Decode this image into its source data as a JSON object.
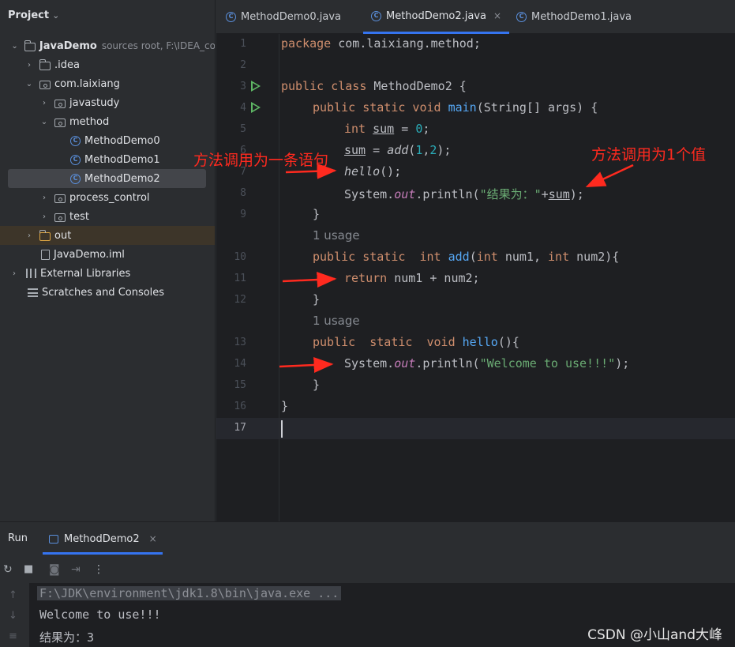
{
  "project_panel": {
    "title": "Project",
    "tree": [
      {
        "label": "JavaDemo",
        "note": "sources root,  F:\\IDEA_co"
      },
      {
        "label": ".idea"
      },
      {
        "label": "com.laixiang"
      },
      {
        "label": "javastudy"
      },
      {
        "label": "method"
      },
      {
        "label": "MethodDemo0"
      },
      {
        "label": "MethodDemo1"
      },
      {
        "label": "MethodDemo2"
      },
      {
        "label": "process_control"
      },
      {
        "label": "test"
      },
      {
        "label": "out"
      },
      {
        "label": "JavaDemo.iml"
      },
      {
        "label": "External Libraries"
      },
      {
        "label": "Scratches and Consoles"
      }
    ]
  },
  "editor_tabs": [
    {
      "label": "MethodDemo0.java"
    },
    {
      "label": "MethodDemo2.java",
      "active": true
    },
    {
      "label": "MethodDemo1.java"
    }
  ],
  "editor": {
    "line_numbers": [
      "1",
      "2",
      "3",
      "4",
      "5",
      "6",
      "7",
      "8",
      "9",
      "10",
      "11",
      "12",
      "13",
      "14",
      "15",
      "16",
      "17"
    ],
    "code": {
      "l1_kw": "package",
      "l1_rest": " com.laixiang.method;",
      "l3_kw": "public class",
      "l3_rest": " MethodDemo2 {",
      "l4_kw": "public static void",
      "l4_fn": "main",
      "l4_rest": "(String[] args) {",
      "l5_kw": "int",
      "l5_var": "sum",
      "l5_mid": " = ",
      "l5_num": "0",
      "l5_end": ";",
      "l6_var": "sum",
      "l6_mid": " = ",
      "l6_call": "add",
      "l6_p1": "(",
      "l6_n1": "1",
      "l6_c": ",",
      "l6_n2": "2",
      "l6_end": ");",
      "l7_call": "hello",
      "l7_end": "();",
      "l8_a": "System.",
      "l8_field": "out",
      "l8_b": ".println(",
      "l8_str": "\"结果为：\"",
      "l8_plus": "+",
      "l8_var": "sum",
      "l8_end": ");",
      "l9": "}",
      "l10_kw": "public static",
      "l10_sp": "  ",
      "l10_kw2": "int",
      "l10_fn": "add",
      "l10_p": "(",
      "l10_kw3": "int",
      "l10_a": " num1, ",
      "l10_kw4": "int",
      "l10_b": " num2){",
      "l11_kw": "return",
      "l11_rest": " num1 + num2;",
      "l12": "}",
      "l13_kw": "public",
      "l13_sp": "  ",
      "l13_kw2": "static",
      "l13_sp2": "  ",
      "l13_kw3": "void",
      "l13_fn": "hello",
      "l13_rest": "(){",
      "l14_a": "System.",
      "l14_field": "out",
      "l14_b": ".println(",
      "l14_str": "\"Welcome to use!!!\"",
      "l14_end": ");",
      "l15": "}",
      "l16": "}"
    },
    "usage_hints": [
      "1 usage",
      "1 usage"
    ]
  },
  "annotations": {
    "left": "方法调用为一条语句",
    "right": "方法调用为1个值"
  },
  "run_panel": {
    "title": "Run",
    "tab_label": "MethodDemo2",
    "output": [
      "F:\\JDK\\environment\\jdk1.8\\bin\\java.exe ...",
      "Welcome to use!!!",
      "结果为：3"
    ],
    "watermark": "CSDN @小山and大峰"
  },
  "colors": {
    "accent": "#3574f0",
    "keyword": "#cf8e6d",
    "function": "#56a8f5",
    "string": "#6aab73",
    "number": "#2aacb8",
    "annotation": "#ff2a1f"
  }
}
